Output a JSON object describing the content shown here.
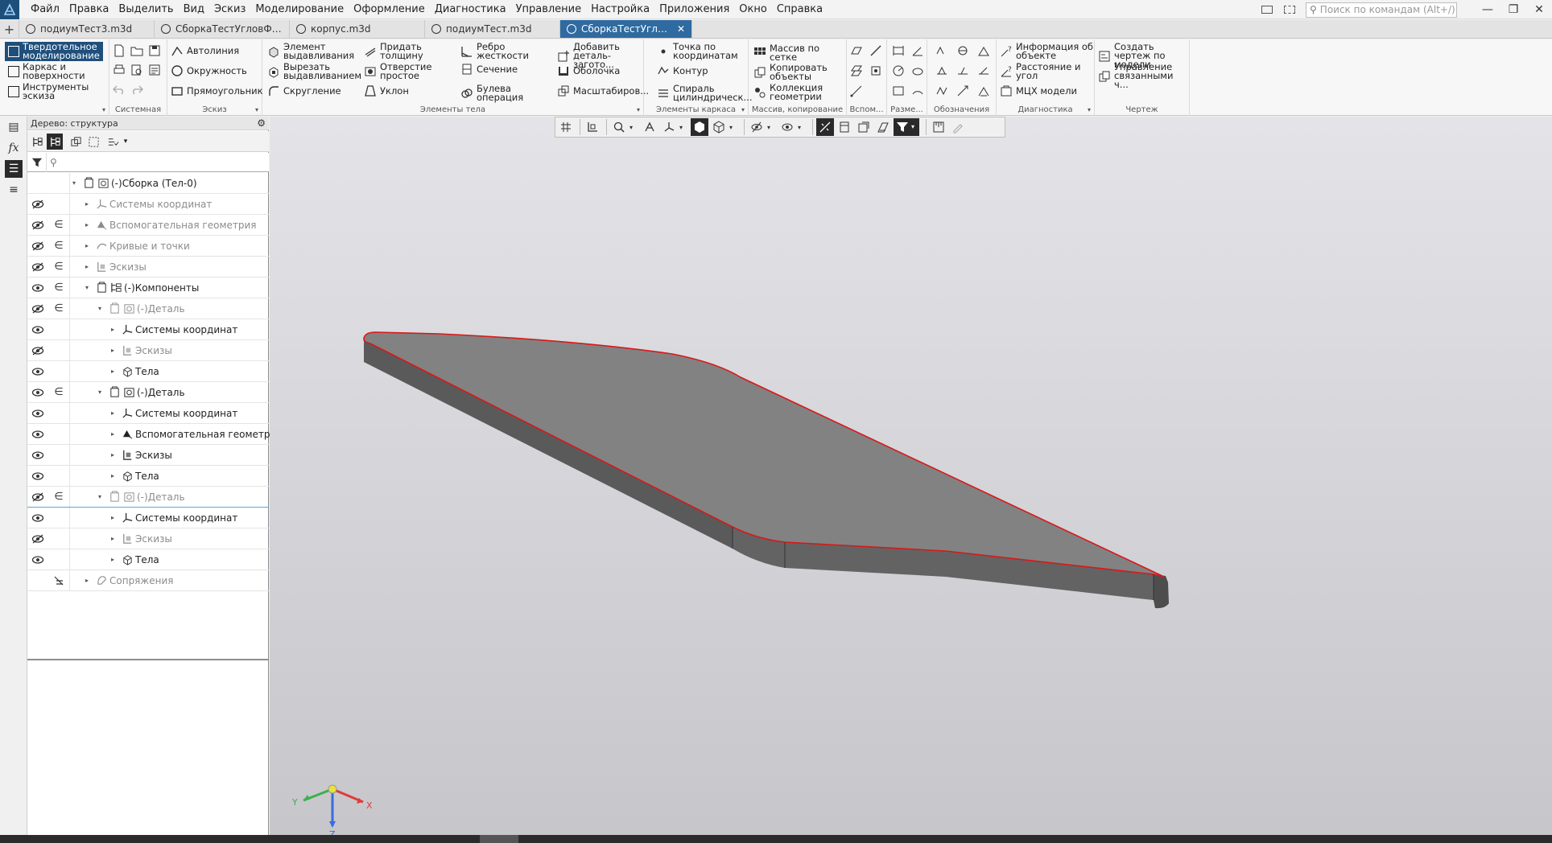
{
  "menu": {
    "items": [
      "Файл",
      "Правка",
      "Выделить",
      "Вид",
      "Эскиз",
      "Моделирование",
      "Оформление",
      "Диагностика",
      "Управление",
      "Настройка",
      "Приложения",
      "Окно",
      "Справка"
    ],
    "search_placeholder": "Поиск по командам (Alt+/)"
  },
  "tabs": [
    {
      "label": "подиумТест3.m3d",
      "active": false
    },
    {
      "label": "СборкаТестУгловФи...",
      "active": false
    },
    {
      "label": "корпус.m3d",
      "active": false
    },
    {
      "label": "подиумТест.m3d",
      "active": false
    },
    {
      "label": "СборкаТестУглов.m...",
      "active": true
    }
  ],
  "ribbon": {
    "modes": [
      "Твердотельное моделирование",
      "Каркас и поверхности",
      "Инструменты эскиза"
    ],
    "groups": {
      "system": "Системная",
      "sketch": "Эскиз",
      "body": "Элементы тела",
      "frame": "Элементы каркаса",
      "array": "Массив, копирование",
      "aux": "Вспом...",
      "dims": "Разме...",
      "designations": "Обозначения",
      "diagnostics": "Диагностика",
      "drawing": "Чертеж"
    },
    "sketch_buttons": [
      "Автолиния",
      "Окружность",
      "Прямоугольник"
    ],
    "body_buttons": {
      "col1": [
        "Элемент выдавливания",
        "Вырезать выдавливанием",
        "Скругление"
      ],
      "col2": [
        "Придать толщину",
        "Отверстие простое",
        "Уклон"
      ],
      "col3": [
        "Ребро жесткости",
        "Сечение",
        "Булева операция"
      ],
      "col4": [
        "Добавить деталь-загото...",
        "Оболочка",
        "Масштабиров..."
      ]
    },
    "frame_buttons": [
      "Точка по координатам",
      "Контур",
      "Спираль цилиндрическ..."
    ],
    "array_buttons": [
      "Массив по сетке",
      "Копировать объекты",
      "Коллекция геометрии"
    ],
    "diagnostics_buttons": [
      "Информация об объекте",
      "Расстояние и угол",
      "МЦХ модели"
    ],
    "drawing_buttons": [
      "Создать чертеж по модели",
      "Управление связанными ч..."
    ]
  },
  "tree": {
    "title": "Дерево: структура",
    "rows": [
      {
        "label": "(-)Сборка (Тел-0)",
        "indent": 0,
        "expanded": true,
        "dim": false,
        "eye": "",
        "inc": false,
        "icon": "assembly"
      },
      {
        "label": "Системы координат",
        "indent": 1,
        "expanded": false,
        "dim": true,
        "eye": "hidden",
        "inc": false,
        "icon": "coord"
      },
      {
        "label": "Вспомогательная геометрия",
        "indent": 1,
        "expanded": false,
        "dim": true,
        "eye": "hidden",
        "inc": true,
        "icon": "auxgeom"
      },
      {
        "label": "Кривые и точки",
        "indent": 1,
        "expanded": false,
        "dim": true,
        "eye": "hidden",
        "inc": true,
        "icon": "curve"
      },
      {
        "label": "Эскизы",
        "indent": 1,
        "expanded": false,
        "dim": true,
        "eye": "hidden",
        "inc": true,
        "icon": "sketch"
      },
      {
        "label": "(-)Компоненты",
        "indent": 1,
        "expanded": true,
        "dim": false,
        "eye": "visible",
        "inc": true,
        "icon": "components"
      },
      {
        "label": "(-)Деталь",
        "indent": 2,
        "expanded": true,
        "dim": true,
        "eye": "hidden",
        "inc": true,
        "icon": "part"
      },
      {
        "label": "Системы координат",
        "indent": 3,
        "expanded": false,
        "dim": false,
        "eye": "visible",
        "inc": false,
        "icon": "coord"
      },
      {
        "label": "Эскизы",
        "indent": 3,
        "expanded": false,
        "dim": true,
        "eye": "hidden",
        "inc": false,
        "icon": "sketch"
      },
      {
        "label": "Тела",
        "indent": 3,
        "expanded": false,
        "dim": false,
        "eye": "visible",
        "inc": false,
        "icon": "bodies"
      },
      {
        "label": "(-)Деталь",
        "indent": 2,
        "expanded": true,
        "dim": false,
        "eye": "visible",
        "inc": true,
        "icon": "part"
      },
      {
        "label": "Системы координат",
        "indent": 3,
        "expanded": false,
        "dim": false,
        "eye": "visible",
        "inc": false,
        "icon": "coord"
      },
      {
        "label": "Вспомогательная геометрия",
        "indent": 3,
        "expanded": false,
        "dim": false,
        "eye": "visible",
        "inc": false,
        "icon": "auxgeom"
      },
      {
        "label": "Эскизы",
        "indent": 3,
        "expanded": false,
        "dim": false,
        "eye": "visible",
        "inc": false,
        "icon": "sketch"
      },
      {
        "label": "Тела",
        "indent": 3,
        "expanded": false,
        "dim": false,
        "eye": "visible",
        "inc": false,
        "icon": "bodies"
      },
      {
        "label": "(-)Деталь",
        "indent": 2,
        "expanded": true,
        "dim": true,
        "eye": "hidden",
        "inc": true,
        "icon": "part",
        "selected": true
      },
      {
        "label": "Системы координат",
        "indent": 3,
        "expanded": false,
        "dim": false,
        "eye": "visible",
        "inc": false,
        "icon": "coord"
      },
      {
        "label": "Эскизы",
        "indent": 3,
        "expanded": false,
        "dim": true,
        "eye": "hidden",
        "inc": false,
        "icon": "sketch"
      },
      {
        "label": "Тела",
        "indent": 3,
        "expanded": false,
        "dim": false,
        "eye": "visible",
        "inc": false,
        "icon": "bodies"
      },
      {
        "label": "Сопряжения",
        "indent": 1,
        "expanded": false,
        "dim": true,
        "eye": "",
        "inc": "mate",
        "icon": "mates"
      }
    ]
  },
  "axes": {
    "x": "X",
    "y": "Y",
    "z": "Z"
  },
  "colors": {
    "accent": "#1f4f7c",
    "active_tab": "#2f6aa0",
    "model_face": "#818181",
    "model_side": "#5b5b5b",
    "edge_highlight": "#d81818",
    "axis_x": "#e03a3a",
    "axis_y": "#3ab14a",
    "axis_z": "#3a6be0"
  }
}
